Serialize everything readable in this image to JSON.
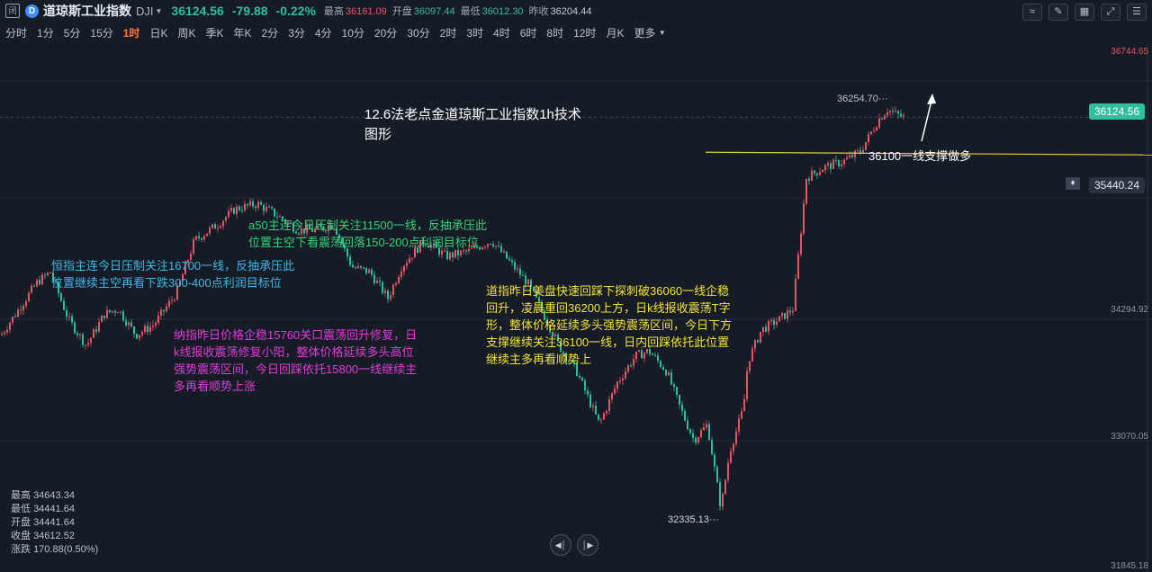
{
  "header": {
    "app_icon": "闭",
    "logo_text": "D",
    "symbol_name": "道琼斯工业指数",
    "symbol_code": "DJI",
    "last_price": "36124.56",
    "change": "-79.88",
    "change_pct": "-0.22%",
    "stats": [
      {
        "label": "最高",
        "value": "36161.09",
        "tone": "up"
      },
      {
        "label": "开盘",
        "value": "36097.44",
        "tone": "dn"
      },
      {
        "label": "最低",
        "value": "36012.30",
        "tone": "dn"
      },
      {
        "label": "昨收",
        "value": "36204.44",
        "tone": "neu"
      }
    ],
    "tool_icons": [
      "line-chart-icon",
      "draw-pen-icon",
      "indicator-icon",
      "expand-icon",
      "candle-settings-icon"
    ]
  },
  "periods": [
    "分时",
    "1分",
    "5分",
    "15分",
    "1时",
    "日K",
    "周K",
    "季K",
    "年K",
    "2分",
    "3分",
    "4分",
    "10分",
    "20分",
    "30分",
    "2时",
    "3时",
    "4时",
    "6时",
    "8时",
    "12时",
    "月K",
    "更多"
  ],
  "active_period": "1时",
  "axis_labels": [
    "36744.65",
    "34294.92",
    "33070.05",
    "31845.18"
  ],
  "current_price_tag": "36124.56",
  "alert_price_tag": "35440.24",
  "max_label": "36254.70",
  "min_label": "32335.13",
  "annotations": {
    "title": "12.6法老点金道琼斯工业指数1h技术\n图形",
    "support": "36100一线支撑做多",
    "hsi": "恒指主连今日压制关注16700一线，反抽承压此\n位置继续主空再看下跌300-400点利润目标位",
    "a50": "a50主连今日压制关注11500一线，反抽承压此\n位置主空下看震荡回落150-200点利润目标位",
    "nasdaq": "纳指昨日价格企稳15760关口震荡回升修复，日\nk线报收震荡修复小阳，整体价格延续多头高位\n强势震荡区间，今日回踩依托15800一线继续主\n多再看顺势上涨",
    "dow": "道指昨日美盘快速回踩下探刺破36060一线企稳\n回升，凌晨重回36200上方，日k线报收震荡T字\n形，整体价格延续多头强势震荡区间，今日下方\n支撑继续关注36100一线，日内回踩依托此位置\n继续主多再看顺势上"
  },
  "ohlc_panel": [
    {
      "label": "最高",
      "value": "34643.34"
    },
    {
      "label": "最低",
      "value": "34441.64"
    },
    {
      "label": "开盘",
      "value": "34441.64"
    },
    {
      "label": "收盘",
      "value": "34612.52"
    },
    {
      "label": "涨跌",
      "value": "170.88(0.50%)"
    }
  ],
  "colors": {
    "up": "#e85463",
    "down": "#2fbf9e",
    "support_line": "#e8d23a",
    "bg": "#161c26"
  },
  "chart_data": {
    "type": "candlestick",
    "ylim": [
      31845.18,
      36744.65
    ],
    "y_ticks": [
      36744.65,
      34294.92,
      33070.05,
      31845.18
    ],
    "path": [
      [
        0,
        34050
      ],
      [
        20,
        34300
      ],
      [
        40,
        34550
      ],
      [
        55,
        34650
      ],
      [
        75,
        34200
      ],
      [
        95,
        33950
      ],
      [
        115,
        34250
      ],
      [
        130,
        34300
      ],
      [
        150,
        34050
      ],
      [
        170,
        34150
      ],
      [
        195,
        34450
      ],
      [
        215,
        34950
      ],
      [
        240,
        35100
      ],
      [
        260,
        35250
      ],
      [
        285,
        35300
      ],
      [
        305,
        35200
      ],
      [
        330,
        35050
      ],
      [
        350,
        35050
      ],
      [
        370,
        35100
      ],
      [
        390,
        34700
      ],
      [
        410,
        34650
      ],
      [
        430,
        34400
      ],
      [
        445,
        34700
      ],
      [
        470,
        34950
      ],
      [
        495,
        34800
      ],
      [
        520,
        34850
      ],
      [
        545,
        34950
      ],
      [
        565,
        34750
      ],
      [
        585,
        34550
      ],
      [
        600,
        34300
      ],
      [
        620,
        33950
      ],
      [
        640,
        33700
      ],
      [
        655,
        33400
      ],
      [
        665,
        33200
      ],
      [
        685,
        33600
      ],
      [
        705,
        33850
      ],
      [
        720,
        33900
      ],
      [
        740,
        33700
      ],
      [
        755,
        33350
      ],
      [
        770,
        33050
      ],
      [
        785,
        33200
      ],
      [
        800,
        32400
      ],
      [
        810,
        32950
      ],
      [
        825,
        33350
      ],
      [
        830,
        33800
      ],
      [
        845,
        34100
      ],
      [
        865,
        34200
      ],
      [
        880,
        34300
      ],
      [
        895,
        35550
      ],
      [
        915,
        35650
      ],
      [
        935,
        35700
      ],
      [
        955,
        35800
      ],
      [
        975,
        36100
      ],
      [
        985,
        36200
      ],
      [
        995,
        36150
      ],
      [
        1005,
        36120
      ]
    ],
    "support_level": 36100,
    "max_marker": 36254.7,
    "min_marker": 32335.13
  }
}
